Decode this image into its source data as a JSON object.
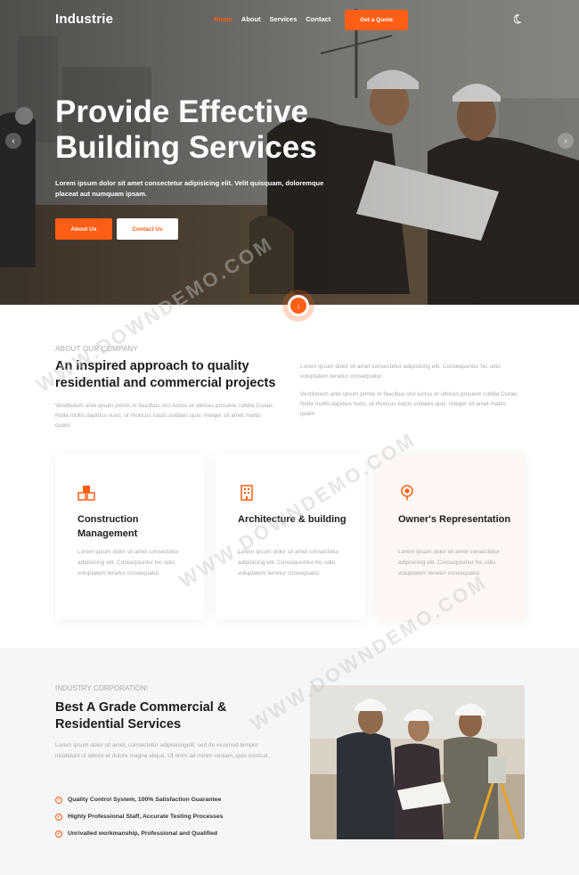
{
  "nav": {
    "logo": "Industrie",
    "links": [
      "Home",
      "About",
      "Services",
      "Contact"
    ],
    "cta": "Get a Quote"
  },
  "hero": {
    "title": "Provide Effective Building Services",
    "text": "Lorem ipsum dolor sit amet consectetur adipisicing elit. Velit quisquam, doloremque placeat aut numquam ipsam.",
    "btn_about": "About Us",
    "btn_contact": "Contact Us",
    "prev_icon": "‹",
    "next_icon": "›",
    "scroll_icon": "↓"
  },
  "about": {
    "label": "ABOUT OUR COMPANY",
    "title": "An inspired approach to quality residential and commercial projects",
    "p1": "Vestibulum ante ipsum primis in faucibus orci luctus et ultrices posuere cubilia Curae; Nulla mollis dapibus nunc, ut rhoncus turpis sodales quis. Integer sit amet mattis quam.",
    "p2": "Lorem ipsum dolor sit amet consectetur adipisicing elit. Consequuntur hic odio voluptatem tenetur consequatur.",
    "p3": "Vestibulum ante ipsum primis in faucibus orci luctus et ultrices posuere cubilia Curae; Nulla mollis dapibus nunc, ut rhoncus turpis sodales quis. Integer sit amet mattis quam."
  },
  "services": [
    {
      "title": "Construction Management",
      "text": "Lorem ipsum dolor sit amet consectetur adipisicing elit. Consequuntur hic odio voluptatem tenetur consequatur.",
      "icon": "boxes-icon"
    },
    {
      "title": "Architecture & building",
      "text": "Lorem ipsum dolor sit amet consectetur adipisicing elit. Consequuntur hic odio voluptatem tenetur consequatur.",
      "icon": "building-icon"
    },
    {
      "title": "Owner's Representation",
      "text": "Lorem ipsum dolor sit amet consectetur adipisicing elit. Consequuntur hic odio voluptatem tenetur consequatur.",
      "icon": "location-pin-icon"
    }
  ],
  "industry": {
    "label": "INDUSTRY CORPORATION!",
    "title": "Best A Grade Commercial & Residential Services",
    "text": "Lorem ipsum dolor sit amet, consectetur adipisicingelit, sed do eiusmod tempor incididunt ut labore et dolore magna aliqua. Ut enim ad minim veniam, quis nostrud.",
    "items": [
      "Quality Control System, 100% Satisfaction Guarantee",
      "Highly Professional Staff, Accurate Testing Processes",
      "Unrivalled workmanship, Professional and Qualified"
    ],
    "check_icon": "✓"
  },
  "watermark": "WWW.DOWNDEMO.COM",
  "colors": {
    "accent": "#ff5e14",
    "dark": "#1c1c1c",
    "muted": "#aaaaaa",
    "soft_bg": "#f4f6f8"
  }
}
